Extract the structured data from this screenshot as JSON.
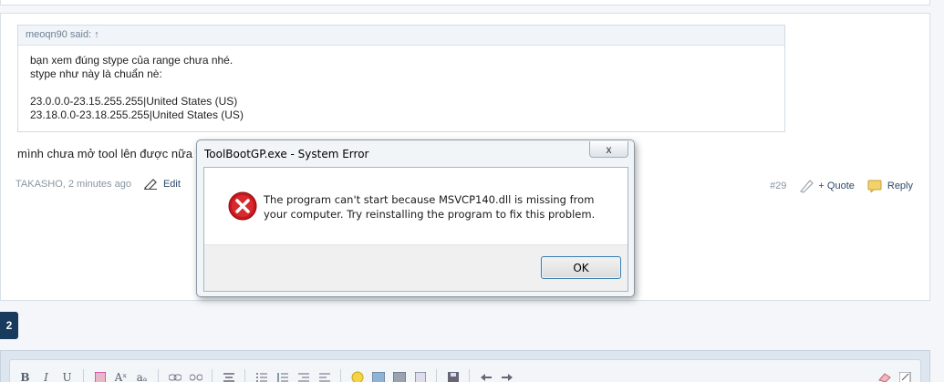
{
  "quote": {
    "author": "meoqn90 said: ↑",
    "lines": [
      "bạn xem đúng stype của range chưa nhé.",
      "stype như này là chuẩn nè:",
      "",
      "23.0.0.0-23.15.255.255|United States (US)",
      "23.18.0.0-23.18.255.255|United States (US)"
    ]
  },
  "post": {
    "text": "mình chưa mở tool lên được nữa",
    "meta": "TAKASHO, 2 minutes ago",
    "edit_label": "Edit",
    "number": "#29",
    "quote_label": "+ Quote",
    "reply_label": "Reply"
  },
  "pagination": {
    "current_page": "2"
  },
  "dialog": {
    "title": "ToolBootGP.exe - System Error",
    "message": "The program can't start because MSVCP140.dll is missing from your computer. Try reinstalling the program to fix this problem.",
    "ok_label": "OK",
    "close_label": "x"
  },
  "toolbar": {
    "bold": "B",
    "italic": "I",
    "underline": "U",
    "font_size": "Aˣ",
    "font_family": "aₐ"
  },
  "colors": {
    "page_btn": "#183a5c",
    "error_red": "#c8161d",
    "link": "#2f4a69"
  }
}
